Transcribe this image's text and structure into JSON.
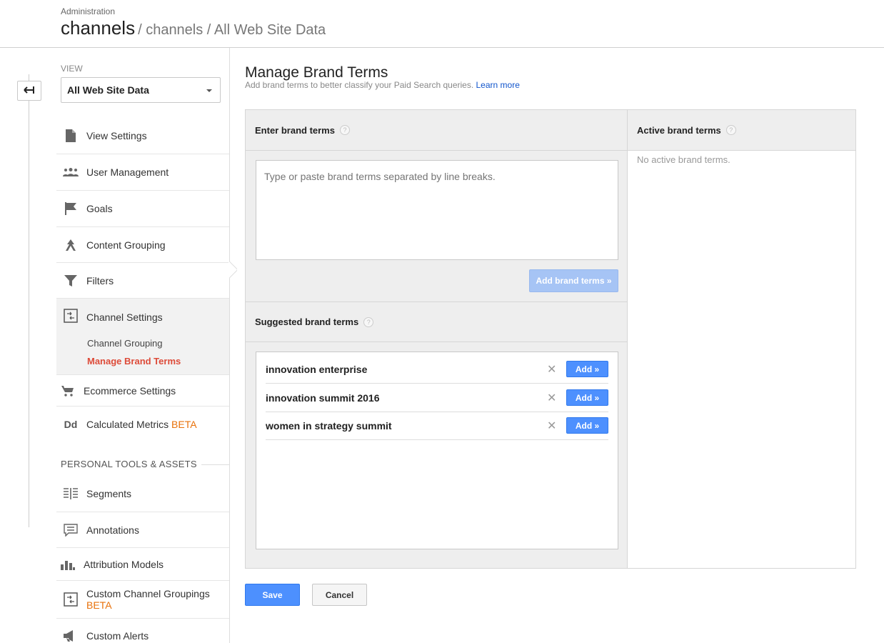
{
  "header": {
    "admin_label": "Administration",
    "crumb_main": "channels",
    "crumb_rest": "/ channels / All Web Site Data"
  },
  "sidebar": {
    "view_label": "VIEW",
    "view_selected": "All Web Site Data",
    "items": [
      {
        "label": "View Settings",
        "icon": "document-icon"
      },
      {
        "label": "User Management",
        "icon": "users-icon"
      },
      {
        "label": "Goals",
        "icon": "flag-icon"
      },
      {
        "label": "Content Grouping",
        "icon": "grouping-icon"
      },
      {
        "label": "Filters",
        "icon": "filter-icon"
      },
      {
        "label": "Channel Settings",
        "icon": "channel-icon"
      },
      {
        "label": "Ecommerce Settings",
        "icon": "cart-icon"
      },
      {
        "label": "Calculated Metrics",
        "badge": "BETA",
        "icon": "dd-icon"
      }
    ],
    "sub_items": [
      "Channel Grouping",
      "Manage Brand Terms"
    ],
    "personal_section": "PERSONAL TOOLS & ASSETS",
    "personal_items": [
      {
        "label": "Segments",
        "icon": "segments-icon"
      },
      {
        "label": "Annotations",
        "icon": "annotation-icon"
      },
      {
        "label": "Attribution Models",
        "icon": "bar-chart-icon"
      },
      {
        "label": "Custom Channel Groupings",
        "badge": "BETA",
        "icon": "channel-icon"
      },
      {
        "label": "Custom Alerts",
        "icon": "megaphone-icon"
      }
    ]
  },
  "main": {
    "title": "Manage Brand Terms",
    "subtitle": "Add brand terms to better classify your Paid Search queries.",
    "learn_more": "Learn more",
    "enter_header": "Enter brand terms",
    "textarea_placeholder": "Type or paste brand terms separated by line breaks.",
    "add_terms_button": "Add brand terms »",
    "suggested_header": "Suggested brand terms",
    "suggested": [
      {
        "term": "innovation enterprise",
        "add": "Add »"
      },
      {
        "term": "innovation summit 2016",
        "add": "Add »"
      },
      {
        "term": "women in strategy summit",
        "add": "Add »"
      }
    ],
    "active_header": "Active brand terms",
    "no_active": "No active brand terms.",
    "save": "Save",
    "cancel": "Cancel"
  }
}
